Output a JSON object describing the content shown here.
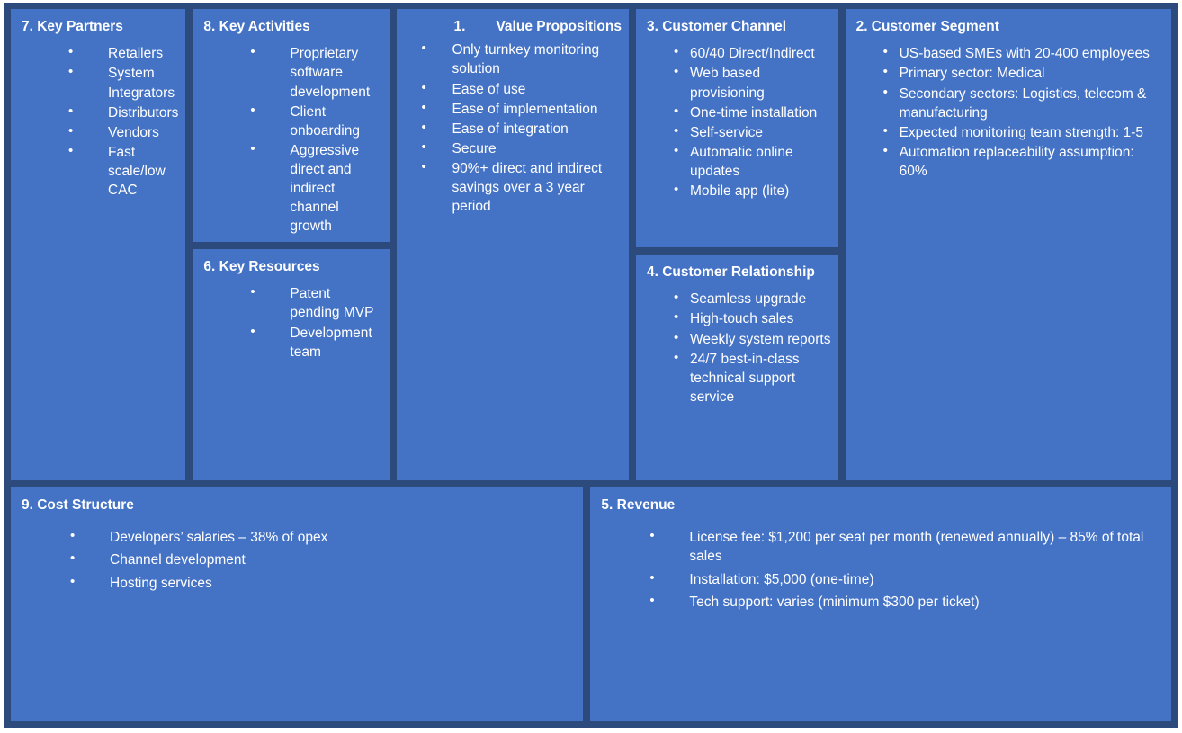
{
  "colors": {
    "cell_fill": "#4472C4",
    "grid_border": "#2D4A7C",
    "text": "#FFFFFF",
    "page_background": "#FFFFFF"
  },
  "blocks": {
    "key_partners": {
      "title": "7. Key Partners",
      "items": [
        "Retailers",
        "System Integrators",
        "Distributors",
        "Vendors",
        "Fast scale/low CAC"
      ]
    },
    "key_activities": {
      "title": "8. Key Activities",
      "items": [
        "Proprietary software development",
        "Client onboarding",
        "Aggressive direct and indirect channel growth"
      ]
    },
    "key_resources": {
      "title": "6. Key Resources",
      "items": [
        "Patent pending MVP",
        "Development team"
      ]
    },
    "value_propositions": {
      "number": "1.",
      "title": "Value Propositions",
      "items": [
        "Only turnkey monitoring solution",
        "Ease of use",
        "Ease of implementation",
        "Ease of integration",
        "Secure",
        "90%+ direct and indirect savings over a 3 year period"
      ]
    },
    "customer_channel": {
      "title": "3. Customer Channel",
      "items": [
        "60/40 Direct/Indirect",
        "Web based provisioning",
        "One-time installation",
        "Self-service",
        "Automatic online updates",
        "Mobile app (lite)"
      ]
    },
    "customer_relationship": {
      "title": "4. Customer Relationship",
      "items": [
        "Seamless upgrade",
        "High-touch sales",
        "Weekly system reports",
        "24/7 best-in-class technical support service"
      ]
    },
    "customer_segment": {
      "title": "2. Customer Segment",
      "items": [
        "US-based SMEs with 20-400 employees",
        "Primary sector: Medical",
        "Secondary sectors: Logistics, telecom & manufacturing",
        "Expected monitoring team strength: 1-5",
        "Automation replaceability assumption: 60%"
      ]
    },
    "cost_structure": {
      "title": "9. Cost Structure",
      "items": [
        "Developers’ salaries – 38% of opex",
        "Channel development",
        "Hosting services"
      ]
    },
    "revenue": {
      "title": "5. Revenue",
      "items": [
        "License fee: $1,200 per seat per month (renewed annually) – 85% of total sales",
        "Installation: $5,000 (one-time)",
        "Tech support: varies (minimum $300 per ticket)"
      ]
    }
  }
}
